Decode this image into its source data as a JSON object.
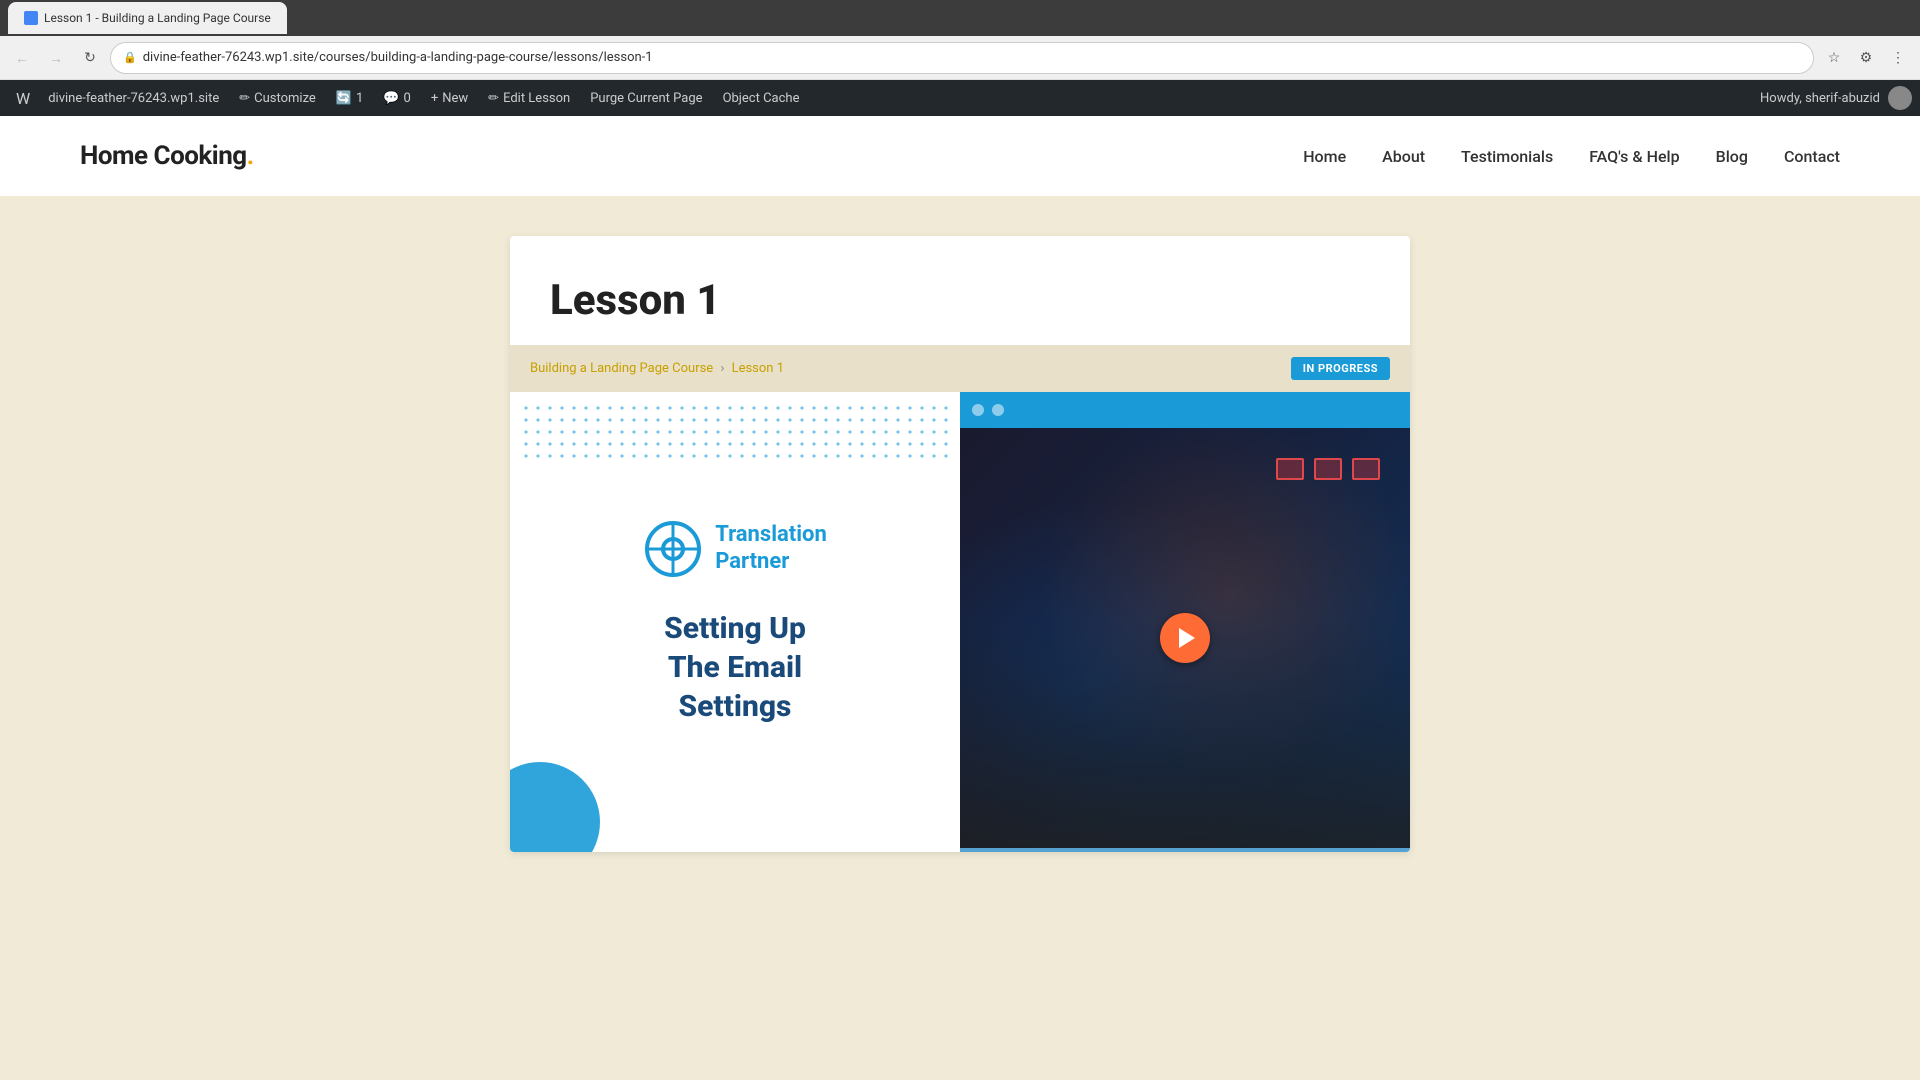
{
  "browser": {
    "tab_label": "Lesson 1 - Building a Landing Page Course",
    "url": "divine-feather-76243.wp1.site/courses/building-a-landing-page-course/lessons/lesson-1",
    "back_button": "←",
    "forward_button": "→",
    "reload_button": "↻"
  },
  "wp_admin_bar": {
    "wp_logo": "W",
    "site_name": "divine-feather-76243.wp1.site",
    "customize_label": "Customize",
    "updates_count": "1",
    "comments_count": "0",
    "new_label": "New",
    "edit_lesson_label": "Edit Lesson",
    "purge_label": "Purge Current Page",
    "object_cache_label": "Object Cache",
    "howdy_text": "Howdy, sherif-abuzid"
  },
  "site_header": {
    "logo_text": "Home Cooking",
    "logo_dot": ".",
    "nav_items": [
      "Home",
      "About",
      "Testimonials",
      "FAQ's & Help",
      "Blog",
      "Contact"
    ]
  },
  "lesson": {
    "title": "Lesson 1",
    "breadcrumb_course": "Building a Landing Page Course",
    "breadcrumb_separator": "›",
    "breadcrumb_current": "Lesson 1",
    "status_badge": "IN PROGRESS"
  },
  "media_left": {
    "logo_text_line1": "Translation",
    "logo_text_line2": "Partner",
    "main_text_line1": "Setting Up",
    "main_text_line2": "The Email",
    "main_text_line3": "Settings"
  },
  "media_right": {
    "dot1": "",
    "dot2": ""
  },
  "colors": {
    "accent_blue": "#1a9bd7",
    "dark_blue": "#1a4a7a",
    "badge_blue": "#1a9bd7",
    "breadcrumb_gold": "#c8a000",
    "play_orange": "#ff6b35",
    "bg_tan": "#f0ead6",
    "admin_bar": "#23282d"
  }
}
